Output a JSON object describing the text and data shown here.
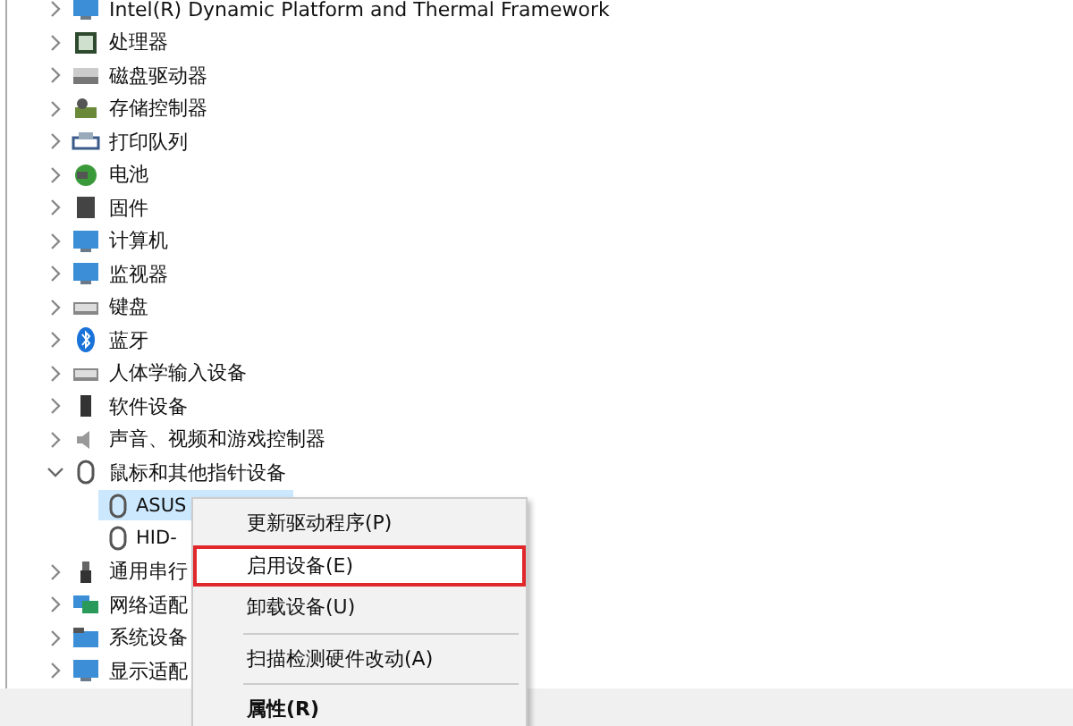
{
  "tree": [
    {
      "label": "Intel(R) Dynamic Platform and Thermal Framework",
      "expanded": false
    },
    {
      "label": "处理器",
      "expanded": false
    },
    {
      "label": "磁盘驱动器",
      "expanded": false
    },
    {
      "label": "存储控制器",
      "expanded": false
    },
    {
      "label": "打印队列",
      "expanded": false
    },
    {
      "label": "电池",
      "expanded": false
    },
    {
      "label": "固件",
      "expanded": false
    },
    {
      "label": "计算机",
      "expanded": false
    },
    {
      "label": "监视器",
      "expanded": false
    },
    {
      "label": "键盘",
      "expanded": false
    },
    {
      "label": "蓝牙",
      "expanded": false
    },
    {
      "label": "人体学输入设备",
      "expanded": false
    },
    {
      "label": "软件设备",
      "expanded": false
    },
    {
      "label": "声音、视频和游戏控制器",
      "expanded": false
    },
    {
      "label": "鼠标和其他指针设备",
      "expanded": true,
      "children": [
        {
          "label": "ASUS",
          "selected": true
        },
        {
          "label": "HID-",
          "selected": false
        }
      ]
    },
    {
      "label": "通用串行",
      "expanded": false
    },
    {
      "label": "网络适配",
      "expanded": false
    },
    {
      "label": "系统设备",
      "expanded": false
    },
    {
      "label": "显示适配",
      "expanded": false
    }
  ],
  "context_menu": [
    {
      "label": "更新驱动程序(P)",
      "selected": false,
      "bold": false
    },
    {
      "label": "启用设备(E)",
      "selected": true,
      "bold": false
    },
    {
      "label": "卸载设备(U)",
      "selected": false,
      "bold": false,
      "separator_after": true
    },
    {
      "label": "扫描检测硬件改动(A)",
      "selected": false,
      "bold": false,
      "separator_after": true
    },
    {
      "label": "属性(R)",
      "selected": false,
      "bold": true
    }
  ]
}
